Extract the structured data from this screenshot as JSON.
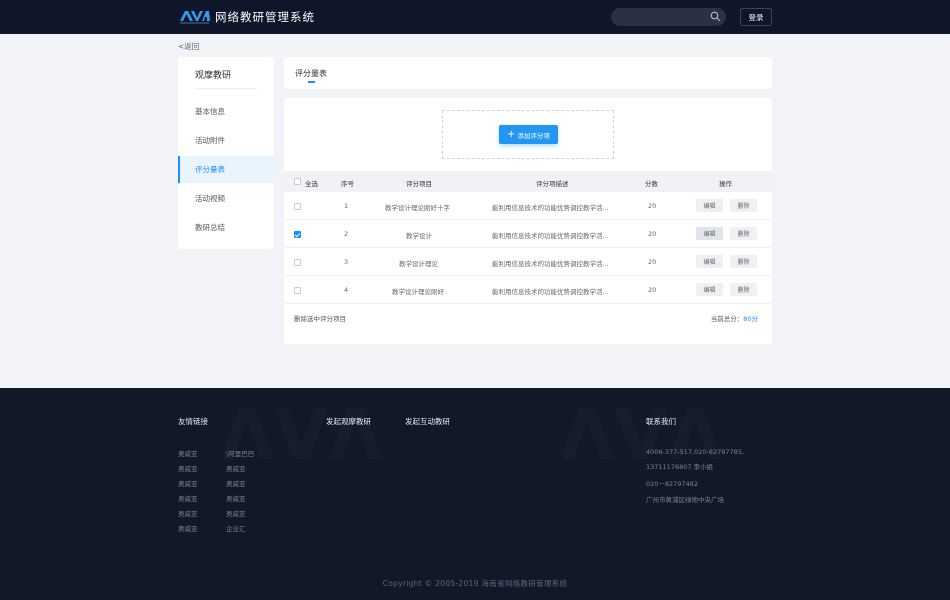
{
  "header": {
    "brand_title": "网络教研管理系统",
    "search_placeholder": "",
    "login_label": "登录"
  },
  "back_link": "<返回",
  "sidebar": {
    "title": "观摩教研",
    "items": [
      {
        "label": "基本信息"
      },
      {
        "label": "活动附件"
      },
      {
        "label": "评分量表"
      },
      {
        "label": "活动视频"
      },
      {
        "label": "教研总结"
      }
    ],
    "active_index": 2
  },
  "tab": {
    "label": "评分量表"
  },
  "add_button_label": "添加评分项",
  "table": {
    "headers": {
      "select_all": "全选",
      "index": "序号",
      "item": "评分项目",
      "description": "评分项描述",
      "score": "分数",
      "actions": "操作"
    },
    "rows": [
      {
        "index": "1",
        "item": "教学设计理论刚好十字",
        "description": "能利用信息技术的功能优势调控教学活...",
        "score": "20",
        "checked": false
      },
      {
        "index": "2",
        "item": "教学设计",
        "description": "能利用信息技术的功能优势调控教学活...",
        "score": "20",
        "checked": true
      },
      {
        "index": "3",
        "item": "教学设计理论",
        "description": "能利用信息技术的功能优势调控教学活...",
        "score": "20",
        "checked": false
      },
      {
        "index": "4",
        "item": "教学设计理论刚好",
        "description": "能利用信息技术的功能优势调控教学活...",
        "score": "20",
        "checked": false
      }
    ],
    "edit_label": "编辑",
    "delete_label": "删除",
    "delete_selected": "删除选中评分项目",
    "total_label": "当前总分：",
    "total_value": "80分"
  },
  "footer": {
    "friend_links_title": "友情链接",
    "friend_links_col1": [
      "奥威亚",
      "奥威亚",
      "奥威亚",
      "奥威亚",
      "奥威亚",
      "奥威亚"
    ],
    "friend_links_col2": [
      "\\阿里巴巴",
      "奥威亚",
      "奥威亚",
      "奥威亚",
      "奥威亚",
      "企业汇"
    ],
    "launch_observe": "发起观摩教研",
    "launch_interactive": "发起互动教研",
    "contact_title": "联系我们",
    "contact_lines": [
      "4006-377-517,020-82797785,",
      "13711176807 李小姐",
      "020－82797482",
      "广州市黄浦区绿地中央广场"
    ],
    "copyright": "Copyright © 2005-2019 海南省网络教研管理系统"
  },
  "colors": {
    "header_bg": "#0f1629",
    "accent": "#1890ff",
    "footer_bg": "#111827"
  }
}
